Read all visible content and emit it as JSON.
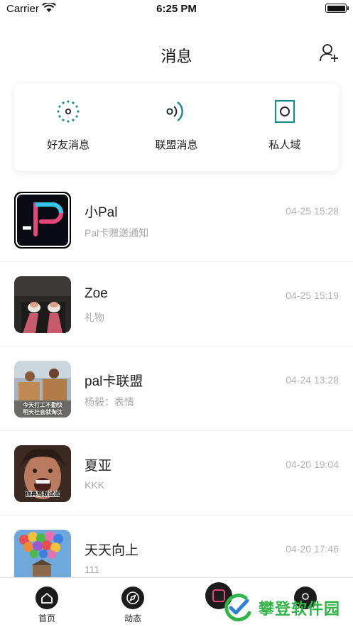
{
  "status_bar": {
    "carrier": "Carrier",
    "time": "6:25 PM"
  },
  "header": {
    "title": "消息"
  },
  "quick_actions": [
    {
      "label": "好友消息",
      "icon": "dotted-circle-icon"
    },
    {
      "label": "联盟消息",
      "icon": "broadcast-icon"
    },
    {
      "label": "私人域",
      "icon": "private-domain-icon"
    }
  ],
  "conversations": [
    {
      "name": "小Pal",
      "preview": "Pal卡赠送通知",
      "time": "04-25 15:28",
      "avatar": "pal-logo"
    },
    {
      "name": "Zoe",
      "preview": "礼物",
      "time": "04-25 15:19",
      "avatar": "photo-feet"
    },
    {
      "name": "pal卡联盟",
      "preview": "杨毅：表情",
      "time": "04-24 13:28",
      "avatar": "photo-meme",
      "avatar_caption": "今天打工不勤快\n明天社会就淘汰"
    },
    {
      "name": "夏亚",
      "preview": "KKK",
      "time": "04-20 19:04",
      "avatar": "photo-meme-face",
      "avatar_caption": "你再骂我试试"
    },
    {
      "name": "天天向上",
      "preview": "111",
      "time": "04-20 17:46",
      "avatar": "photo-balloon-house"
    }
  ],
  "tabs": [
    {
      "label": "首页",
      "icon": "home-icon"
    },
    {
      "label": "动态",
      "icon": "compass-icon"
    },
    {
      "label": "",
      "icon": "card-icon"
    },
    {
      "label": "",
      "icon": "profile-icon"
    }
  ],
  "watermark": {
    "text": "攀登软件园"
  },
  "colors": {
    "accent_teal": "#1f8a8a",
    "pal_pink": "#e8457a",
    "pal_cyan": "#36c6e8",
    "watermark_green": "#31b548"
  }
}
